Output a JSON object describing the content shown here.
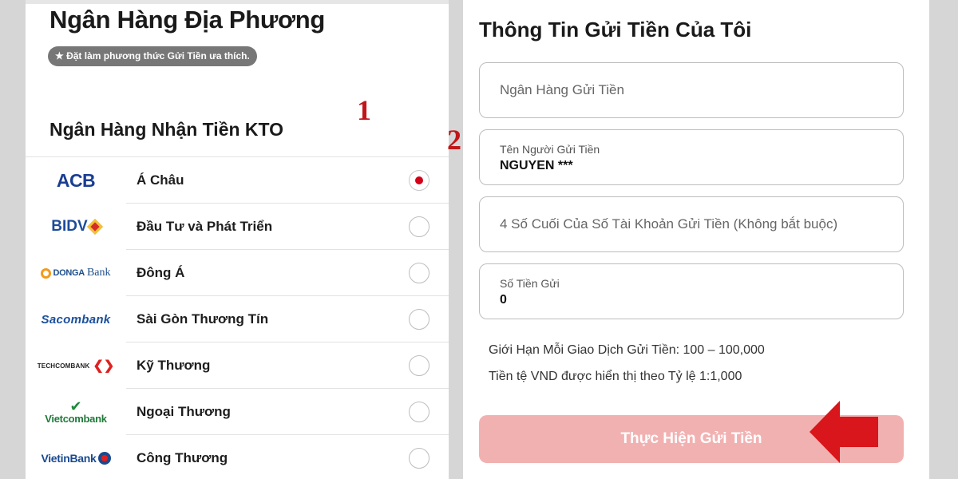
{
  "local_bank": {
    "title": "Ngân Hàng Địa Phương",
    "badge": "★ Đặt làm phương thức Gửi Tiền ưa thích."
  },
  "annotations": {
    "step1": "1",
    "step2": "2"
  },
  "kto_bank": {
    "heading": "Ngân Hàng Nhận Tiền KTO",
    "banks": [
      {
        "logo_text": "ACB",
        "name": "Á Châu",
        "selected": true
      },
      {
        "logo_text": "BIDV",
        "name": "Đầu Tư và Phát Triển",
        "selected": false
      },
      {
        "logo_text": "DONGA",
        "logo_text2": "Bank",
        "name": "Đông Á",
        "selected": false
      },
      {
        "logo_text": "Sacombank",
        "name": "Sài Gòn Thương Tín",
        "selected": false
      },
      {
        "logo_text": "TECHCOMBANK",
        "name": "Kỹ Thương",
        "selected": false
      },
      {
        "logo_text": "Vietcombank",
        "name": "Ngoại Thương",
        "selected": false
      },
      {
        "logo_text": "VietinBank",
        "name": "Công Thương",
        "selected": false
      }
    ]
  },
  "deposit_info": {
    "title": "Thông Tin Gửi Tiền Của Tôi",
    "bank_field": {
      "placeholder": "Ngân Hàng Gửi Tiền"
    },
    "sender_field": {
      "label": "Tên Người Gửi Tiền",
      "value": "NGUYEN ***"
    },
    "account_field": {
      "placeholder": "4 Số Cuối Của Số Tài Khoản Gửi Tiền (Không bắt buộc)"
    },
    "amount_field": {
      "label": "Số Tiền Gửi",
      "value": "0"
    },
    "limit_text": "Giới Hạn Mỗi Giao Dịch Gửi Tiền: 100 – 100,000",
    "currency_text": "Tiền tệ VND được hiển thị theo Tỷ lệ 1:1,000",
    "submit_label": "Thực Hiện Gửi Tiền"
  },
  "colors": {
    "selected_radio": "#d4001a",
    "submit_button": "#f2b1b1",
    "annotation": "#c0161a",
    "arrow": "#d8161b"
  }
}
